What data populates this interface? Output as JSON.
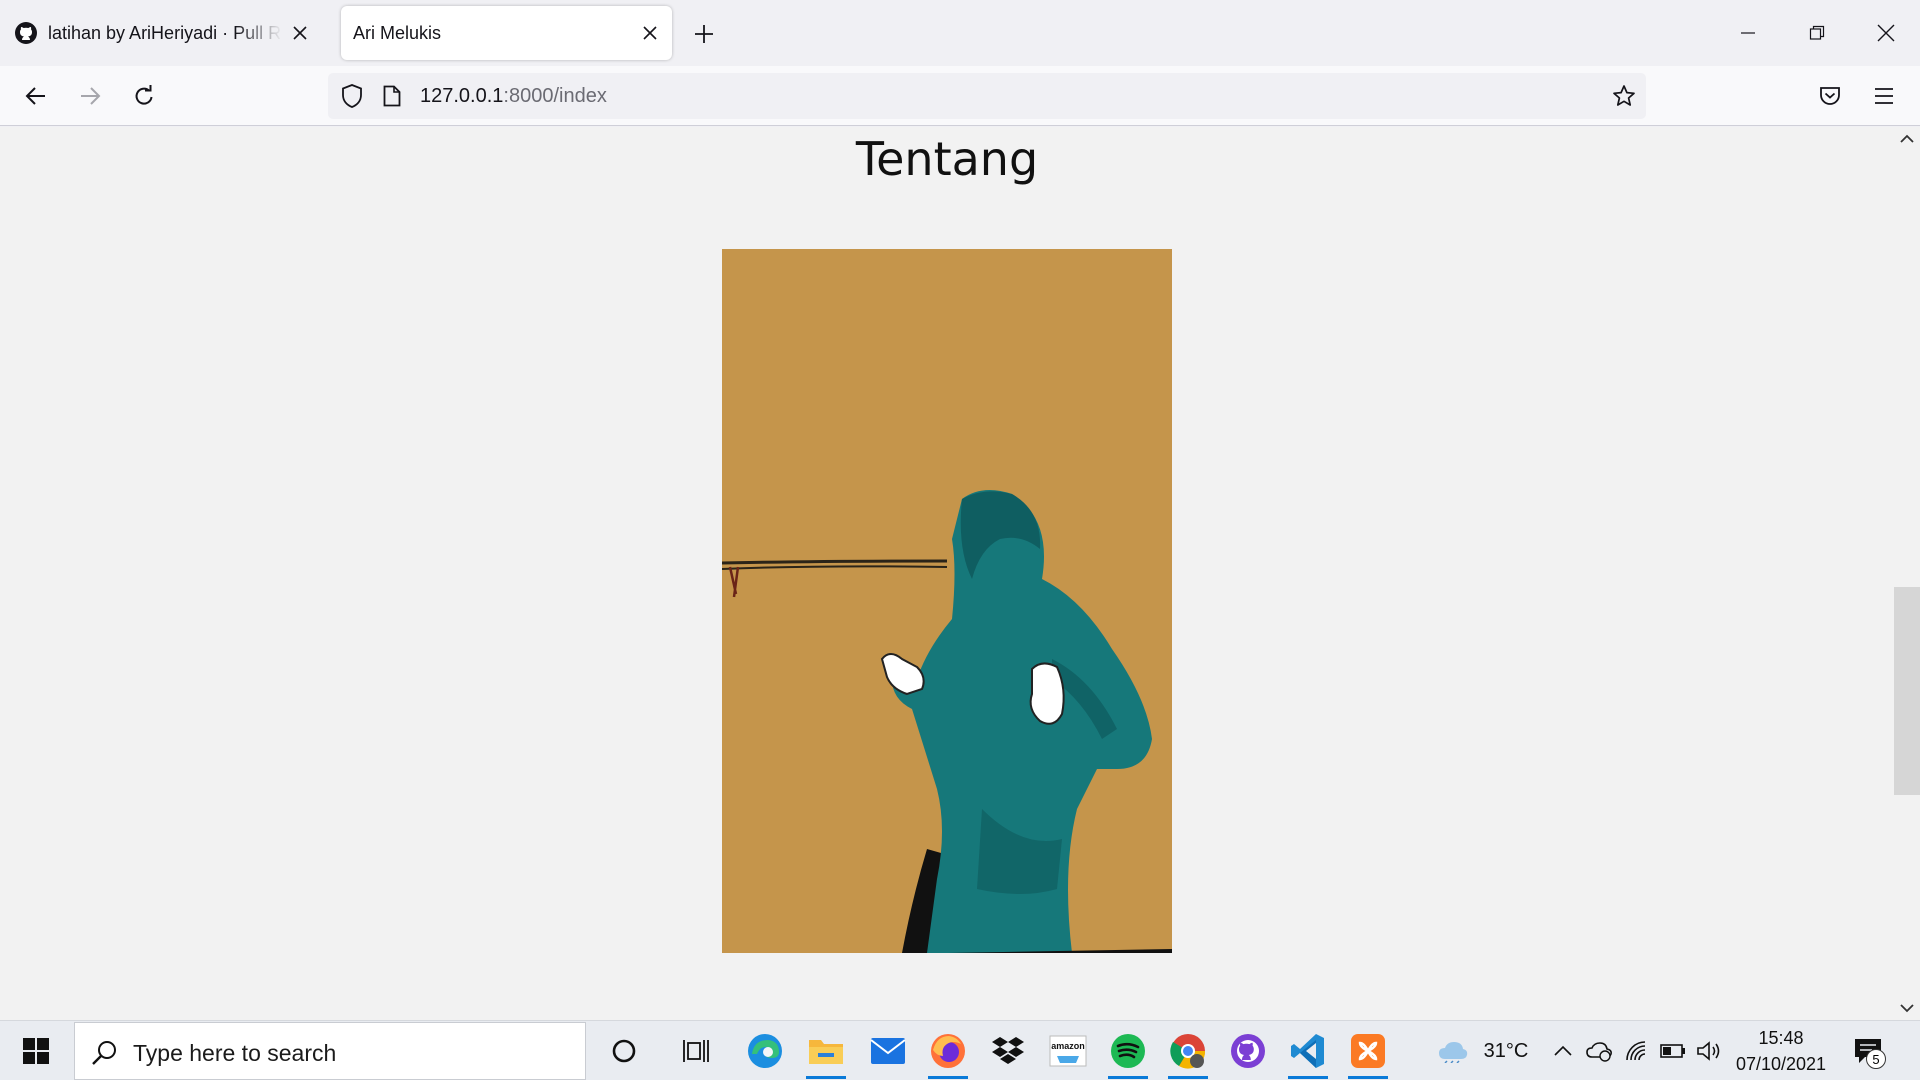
{
  "browser": {
    "tabs": [
      {
        "title": "latihan by AriHeriyadi · Pull Requests",
        "favicon": "github-icon",
        "active": false
      },
      {
        "title": "Ari Melukis",
        "favicon": "",
        "active": true
      }
    ],
    "url_host": "127.0.0.1",
    "url_rest": ":8000/index"
  },
  "page": {
    "heading": "Tentang",
    "image": {
      "subject": "illustration of a person in a teal hoodie with a string tied around the hood, on a mustard background"
    }
  },
  "taskbar": {
    "search_placeholder": "Type here to search",
    "apps": [
      "cortana-icon",
      "task-view-icon",
      "edge-icon",
      "file-explorer-icon",
      "mail-icon",
      "firefox-icon",
      "dropbox-icon",
      "amazon-icon",
      "spotify-icon",
      "chrome-icon",
      "github-desktop-icon",
      "vscode-icon",
      "xampp-icon"
    ],
    "weather": "31°C",
    "time": "15:48",
    "date": "07/10/2021",
    "notification_count": "5"
  },
  "colors": {
    "image_background": "#c9994f",
    "hoodie": "#16787a",
    "accent": "#0a7ad8"
  }
}
